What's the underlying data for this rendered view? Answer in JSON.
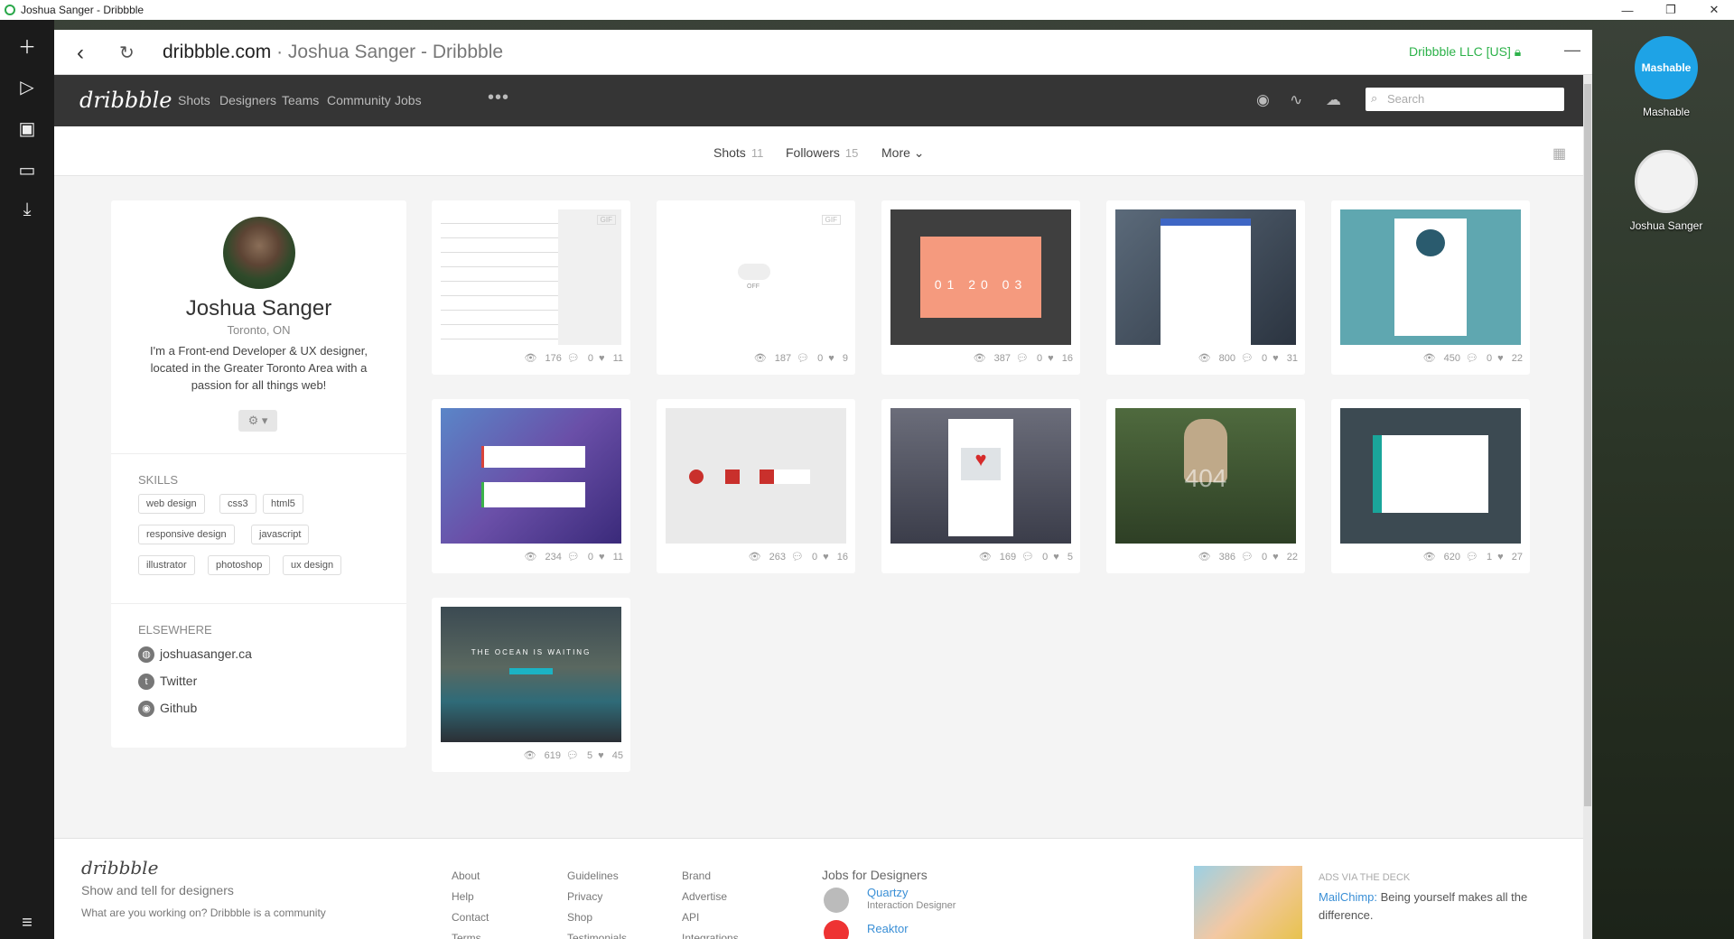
{
  "window": {
    "title": "Joshua Sanger - Dribbble",
    "controls": [
      "—",
      "❐",
      "✕"
    ]
  },
  "leftrail": {
    "icons": [
      "plus-icon",
      "play-icon",
      "camera-icon",
      "image-icon",
      "download-icon",
      "menu-icon"
    ]
  },
  "address": {
    "domain": "dribbble.com",
    "rest": " · Joshua Sanger - Dribbble",
    "ssl": "Dribbble LLC [US]"
  },
  "nav": {
    "brand": "dribbble",
    "links": [
      "Shots",
      "Designers",
      "Teams",
      "Community",
      "Jobs"
    ],
    "more": "•••",
    "search_placeholder": "Search"
  },
  "subnav": {
    "shots_label": "Shots",
    "shots_count": "11",
    "followers_label": "Followers",
    "followers_count": "15",
    "more_label": "More ⌄"
  },
  "profile": {
    "name": "Joshua Sanger",
    "location": "Toronto, ON",
    "bio": "I'm a Front-end Developer & UX designer, located in the Greater Toronto Area with a passion for all things web!",
    "skills_heading": "SKILLS",
    "skills": [
      "web design",
      "css3",
      "html5",
      "responsive design",
      "javascript",
      "illustrator",
      "photoshop",
      "ux design"
    ],
    "elsewhere_heading": "ELSEWHERE",
    "links": [
      "joshuasanger.ca",
      "Twitter",
      "Github"
    ]
  },
  "shots": [
    {
      "views": "176",
      "comments": "0",
      "likes": "11",
      "gif": "GIF"
    },
    {
      "views": "187",
      "comments": "0",
      "likes": "9",
      "gif": "GIF",
      "toggle": "OFF"
    },
    {
      "views": "387",
      "comments": "0",
      "likes": "16",
      "countdown": [
        "01",
        "20",
        "03"
      ]
    },
    {
      "views": "800",
      "comments": "0",
      "likes": "31"
    },
    {
      "views": "450",
      "comments": "0",
      "likes": "22"
    },
    {
      "views": "234",
      "comments": "0",
      "likes": "11"
    },
    {
      "views": "263",
      "comments": "0",
      "likes": "16"
    },
    {
      "views": "169",
      "comments": "0",
      "likes": "5"
    },
    {
      "views": "386",
      "comments": "0",
      "likes": "22",
      "big": "404"
    },
    {
      "views": "620",
      "comments": "1",
      "likes": "27"
    },
    {
      "views": "619",
      "comments": "5",
      "likes": "45",
      "headline": "THE OCEAN IS WAITING"
    }
  ],
  "footer": {
    "brand": "dribbble",
    "tagline": "Show and tell for designers",
    "desc": "What are you working on? Dribbble is a community",
    "col1": [
      "About",
      "Help",
      "Contact",
      "Terms"
    ],
    "col2": [
      "Guidelines",
      "Privacy",
      "Shop",
      "Testimonials"
    ],
    "col3": [
      "Brand",
      "Advertise",
      "API",
      "Integrations"
    ],
    "jobs_heading": "Jobs for Designers",
    "job1_company": "Quartzy",
    "job1_role": "Interaction Designer",
    "job2_company": "Reaktor",
    "ads_heading": "ADS VIA THE DECK",
    "ad_brand": "MailChimp:",
    "ad_text": " Being yourself makes all the difference."
  },
  "dock": [
    {
      "label": "Mashable",
      "badge": "Mashable"
    },
    {
      "label": "Joshua Sanger"
    }
  ],
  "colors": {
    "nav_bg": "#353535",
    "ssl_green": "#2db24a",
    "link_blue": "#3a8fd6"
  }
}
